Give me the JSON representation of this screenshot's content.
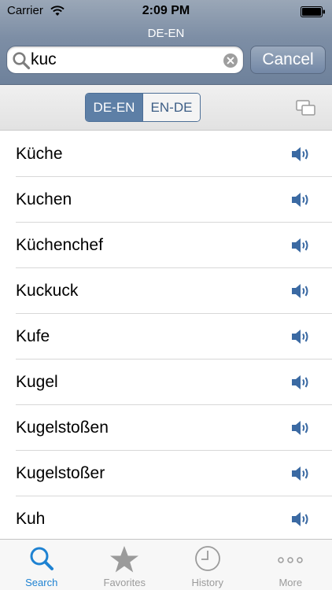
{
  "status_bar": {
    "carrier": "Carrier",
    "time": "2:09 PM"
  },
  "header": {
    "title": "DE-EN"
  },
  "search": {
    "value": "kuc",
    "cancel_label": "Cancel"
  },
  "direction": {
    "options": [
      "DE-EN",
      "EN-DE"
    ],
    "selected": "DE-EN"
  },
  "results": [
    {
      "word": "Küche"
    },
    {
      "word": "Kuchen"
    },
    {
      "word": "Küchenchef"
    },
    {
      "word": "Kuckuck"
    },
    {
      "word": "Kufe"
    },
    {
      "word": "Kugel"
    },
    {
      "word": "Kugelstoßen"
    },
    {
      "word": "Kugelstoßer"
    },
    {
      "word": "Kuh"
    }
  ],
  "tabs": [
    {
      "label": "Search",
      "icon": "search-icon",
      "active": true
    },
    {
      "label": "Favorites",
      "icon": "star-icon",
      "active": false
    },
    {
      "label": "History",
      "icon": "clock-icon",
      "active": false
    },
    {
      "label": "More",
      "icon": "more-icon",
      "active": false
    }
  ],
  "colors": {
    "accent": "#1e82d2",
    "header": "#7d8ea5",
    "segment_active": "#5d7fa6",
    "speaker": "#3b6aa3"
  }
}
